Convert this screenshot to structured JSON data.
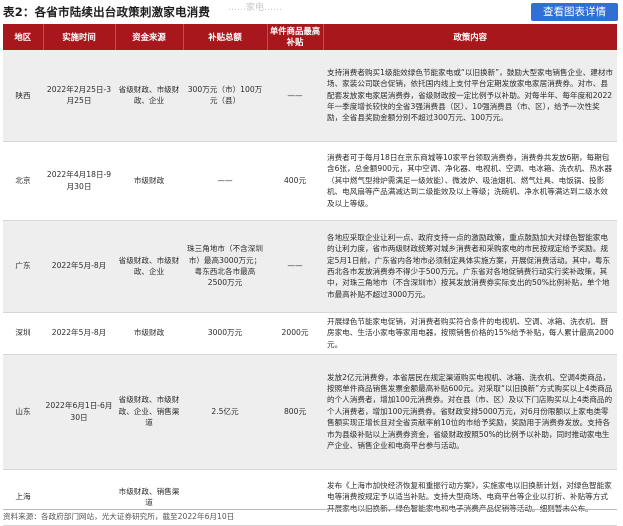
{
  "header": {
    "title": "表2：各省市陆续出台政策刺激家电消费",
    "faded_text": "……家电……",
    "view_button": "查看图表详情"
  },
  "columns": [
    "地区",
    "实施时间",
    "资金来源",
    "补贴总额",
    "单件商品最高补贴",
    "政策内容"
  ],
  "rows": [
    {
      "region": "陕西",
      "time": "2022年2月25日-3月25日",
      "funding": "省级财政、市级财政、企业",
      "total": "300万元（市）100万元（县）",
      "max": "——",
      "content": "支持消费者购买1级能效绿色节能家电或“以旧换新”，鼓励大型家电销售企业、建材市场、家装公司联合促销，依托国内线上支付平台定期发放家电家居消费券。对市、县配套发放家电家居消费券，省级财政按一定比例予以补助。对每半年、每年度和2022年一季度增长较快的全省3强消费县（区）、10强消费县（市、区），给予一次性奖励，全省县奖励金额分别不超过300万元、100万元。"
    },
    {
      "region": "北京",
      "time": "2022年4月18日-9月30日",
      "funding": "市级财政",
      "total": "——",
      "max": "400元",
      "content": "消费者可于每月18日在京东商城等10家平台领取消费券，消费券共发放6期，每期包含6张，总金额900元，其中空调、净化器、电视机、空调、电冰箱、洗衣机、热水器（其中燃气型排炉需满足一级效能）、微波炉、吸油烟机、燃气灶具、电饭锅、投影机、电风扇等产品满减达到二级能效及以上等级；洗碗机、净水机等满达到二级水效及以上等级。"
    },
    {
      "region": "广东",
      "time": "2022年5月-8月",
      "funding": "省级财政、市级财政、企业",
      "total": "珠三角地市（不含深圳市）最高3000万元；粤东西北各市最高2500万元",
      "max": "——",
      "content": "各地应采取企业让利一点、政府支持一点的激励政策，重点鼓励加大对绿色智能家电的让利力度，省市两级财政统筹对城乡消费者和采购家电的市民按规定给予奖励。规定5月1日前，广东省内各地市必须制定具体实施方案，开展促消费活动。其中，粤东西北各市发放消费券不得少于500万元。广东省对各地促销费行动实行奖补政策，其中，对珠三角地市（不含深圳市）按其发放消费券实际支出的50%比例补贴，单个地市最高补贴不超过3000万元。"
    },
    {
      "region": "深圳",
      "time": "2022年5月-8月",
      "funding": "市级财政",
      "total": "3000万元",
      "max": "2000元",
      "content": "开展绿色节能家电促销，对消费者购买符合条件的电视机、空调、冰箱、洗衣机、厨房家电、生活小家电等家用电器，按照销售价格的15%给予补贴，每人累计最高2000元。"
    },
    {
      "region": "山东",
      "time": "2022年6月1日-6月30日",
      "funding": "省级财政、市级财政、企业、销售渠道",
      "total": "2.5亿元",
      "max": "800元",
      "content": "发放2亿元消费券，本省居民在规定渠道购买电视机、冰箱、洗衣机、空调4类商品，按照单件商品销售发票金额最高补贴600元。对采取“以旧换新”方式购买以上4类商品的个人消费者，增加100元消费券。对在县（市、区）及以下门店购买以上4类商品的个人消费者，增加100元消费券。省财政安排5000万元，对6月份限额以上家电类零售额实现正增长且对全省贡献率前10位的市给予奖励，奖励用于消费券发放。支持各市为县级补贴以上消费券资金，省级财政按照50%的比例予以补助，同时推动家电生产企业、销售企业和电商平台参与活动。"
    },
    {
      "region": "上海",
      "time": "",
      "funding": "市级财政、销售渠道",
      "total": "",
      "max": "",
      "content": "发布《上海市加快经济恢复和重振行动方案》，实施家电以旧换新计划，对绿色智能家电等消费按规定予以适当补贴。支持大型商场、电商平台等企业以打折、补贴等方式开展家电以旧换新、绿色智能家电和电子消费产品促销等活动。细则暂未公布。"
    }
  ],
  "source": "资料来源：各政府部门网站，光大证券研究所，截至2022年6月10日"
}
